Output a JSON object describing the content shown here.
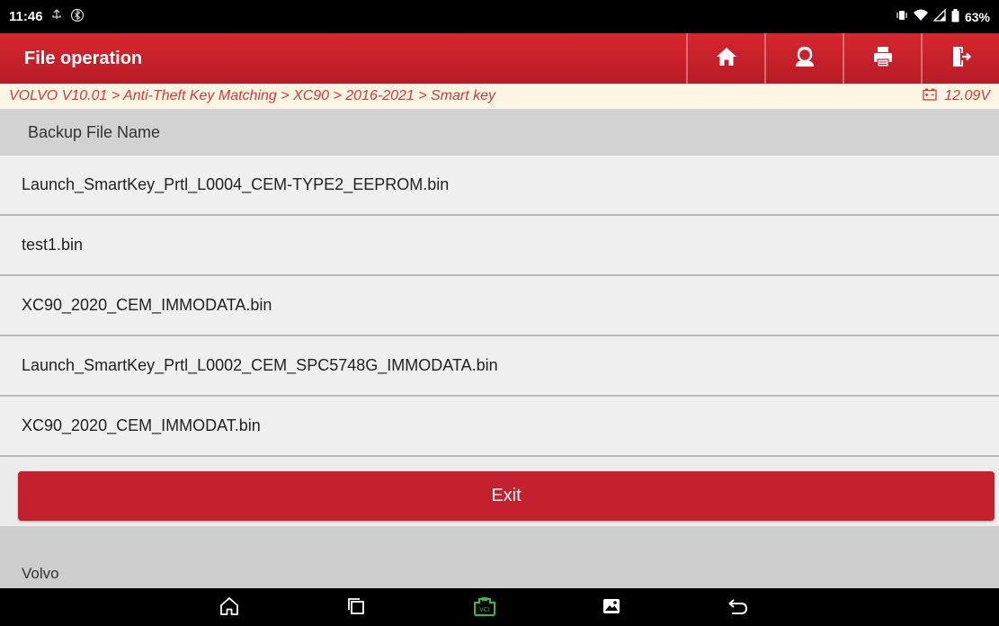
{
  "status_bar": {
    "time": "11:46",
    "battery": "63%",
    "icons": [
      "usb-icon",
      "bluetooth-icon",
      "vibrate-icon",
      "wifi-icon",
      "signal-icon",
      "battery-icon"
    ]
  },
  "header": {
    "title": "File operation",
    "buttons": [
      "home-icon",
      "support-icon",
      "print-icon",
      "exit-door-icon"
    ]
  },
  "breadcrumb": {
    "path": "VOLVO V10.01 > Anti-Theft Key Matching > XC90 > 2016-2021 > Smart key",
    "voltage": "12.09V"
  },
  "list": {
    "header": "Backup File Name",
    "files": [
      "Launch_SmartKey_Prtl_L0004_CEM-TYPE2_EEPROM.bin",
      "test1.bin",
      "XC90_2020_CEM_IMMODATA.bin",
      "Launch_SmartKey_Prtl_L0002_CEM_SPC5748G_IMMODATA.bin",
      "XC90_2020_CEM_IMMODAT.bin"
    ]
  },
  "actions": {
    "exit_label": "Exit"
  },
  "footer": {
    "brand": "Volvo"
  },
  "nav_bar": {
    "buttons": [
      "home-outline-icon",
      "recents-icon",
      "vci-icon",
      "screenshot-icon",
      "back-icon"
    ],
    "vci_label": "VCI",
    "accent": "#2fbf3a"
  },
  "colors": {
    "primary": "#c4202f",
    "breadcrumb_text": "#d23a33"
  }
}
